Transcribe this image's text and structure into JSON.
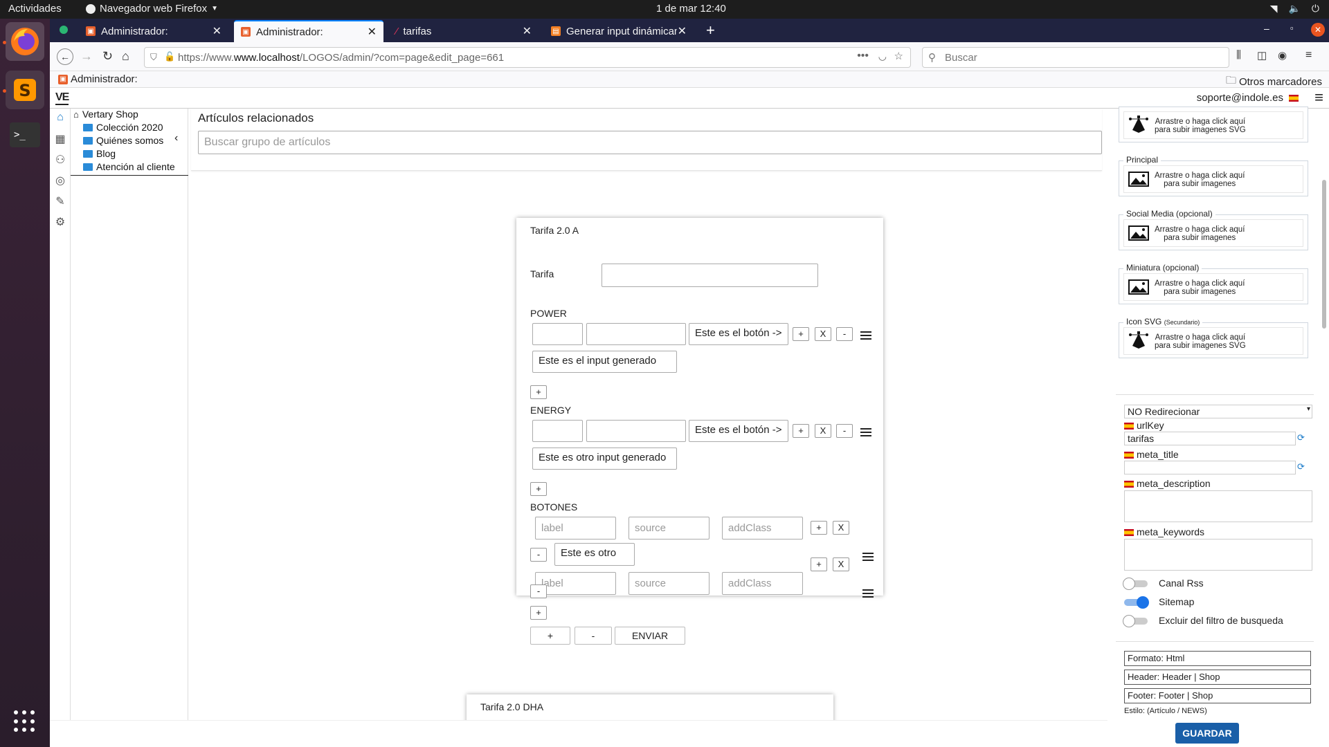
{
  "system": {
    "activities": "Actividades",
    "app_name": "Navegador web Firefox",
    "clock": "1 de mar  12:40"
  },
  "browser": {
    "tabs": [
      {
        "label": "Administrador:"
      },
      {
        "label": "Administrador:"
      },
      {
        "label": "tarifas"
      },
      {
        "label": "Generar input dinámicam"
      }
    ],
    "new_tab": "+",
    "url_prefix": "https://www.",
    "url_host": "www.localhost",
    "url_path": "/LOGOS/admin/?com=page&edit_page=661",
    "search_placeholder": "Buscar",
    "bookmark": "Administrador:",
    "other_bookmarks": "Otros marcadores"
  },
  "app": {
    "logo": "VE",
    "user_email": "soporte@indole.es"
  },
  "tree": {
    "root": "Vertary Shop",
    "items": [
      "Colección 2020",
      "Quiénes somos",
      "Blog",
      "Atención al cliente"
    ]
  },
  "related": {
    "title": "Artículos relacionados",
    "search_placeholder": "Buscar grupo de artículos"
  },
  "card1": {
    "title": "Tarifa 2.0 A",
    "tarifa_label": "Tarifa",
    "power_label": "POWER",
    "power_button_text": "Este es el botón ->",
    "power_generated": "Este es el input generado",
    "energy_label": "ENERGY",
    "energy_button_text": "Este es el botón ->",
    "energy_generated": "Este es otro input generado",
    "botones_label": "BOTONES",
    "ph_label": "label",
    "ph_source": "source",
    "ph_addclass": "addClass",
    "botones_generated": "Este es otro",
    "plus": "+",
    "minus": "-",
    "x": "X",
    "enviar": "ENVIAR"
  },
  "card2": {
    "title": "Tarifa 2.0 DHA"
  },
  "right": {
    "uploads": [
      {
        "title": "",
        "text1": "Arrastre o haga click aquí",
        "text2": "para subir imagenes SVG",
        "icon": "svg-pen-icon"
      },
      {
        "title": "Principal",
        "text1": "Arrastre o haga click aquí",
        "text2": "para subir imagenes",
        "icon": "image-icon"
      },
      {
        "title": "Social Media (opcional)",
        "text1": "Arrastre o haga click aquí",
        "text2": "para subir imagenes",
        "icon": "image-icon"
      },
      {
        "title": "Miniatura (opcional)",
        "text1": "Arrastre o haga click aquí",
        "text2": "para subir imagenes",
        "icon": "image-icon"
      },
      {
        "title": "Icon SVG",
        "title_small": "(Secundario)",
        "text1": "Arrastre o haga click aquí",
        "text2": "para subir imagenes SVG",
        "icon": "svg-pen-icon"
      }
    ],
    "redirect": "NO Redirecionar",
    "urlkey_label": "urlKey",
    "urlkey_value": "tarifas",
    "meta_title_label": "meta_title",
    "meta_description_label": "meta_description",
    "meta_keywords_label": "meta_keywords",
    "canal_rss": "Canal Rss",
    "sitemap": "Sitemap",
    "excluir": "Excluir del filtro de busqueda",
    "formato": "Formato: Html",
    "header": "Header: Header | Shop",
    "footer": "Footer: Footer | Shop",
    "estilo": "Estilo: (Artículo / NEWS)",
    "guardar": "GUARDAR"
  }
}
